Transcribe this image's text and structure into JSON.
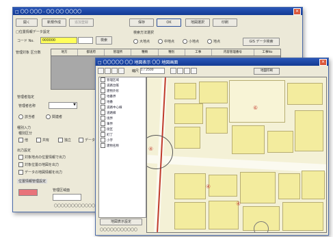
{
  "back_window": {
    "title": "□ 〇〇 〇〇〇 - 〇〇 〇〇 〇〇〇〇",
    "toolbar": [
      "開く",
      "新規作成",
      "追加登録",
      "保存",
      "OK",
      "地図選択",
      "印刷"
    ],
    "section1_label": "□位置情報データ設定",
    "field_label": "コード No.",
    "field_value": "000000",
    "nav_button": "検索",
    "right_group_label": "検索方法選択",
    "radio_options": [
      "大地点",
      "中地点",
      "小地点",
      "地点"
    ],
    "right_button": "GIS データ検索",
    "table_label": "管理対象 区分数",
    "table_headers": [
      "地方",
      "都道府",
      "管理所",
      "種類",
      "種別",
      "工事",
      "内容管理番号",
      "工事No"
    ],
    "lower_group_label": "管理者指定",
    "lower_field_label": "管理者名称",
    "lower_radio_a": "該当者",
    "lower_radio_b": "関連者",
    "block_label": "種別入力",
    "block_sublabel": "種別区分",
    "check_options": [
      "他",
      "共有",
      "独立",
      "データ"
    ],
    "output_label": "出力設定",
    "output_checks": [
      "対象地点の位置情報で出力",
      "対象位置の地図を出力",
      "データの地図情報を出力"
    ],
    "footer_label": "位置情報管理設定",
    "footer_field_label": "管理区域面",
    "footer_field_value": "",
    "status_text": "〇〇〇〇〇〇〇〇〇〇〇〇"
  },
  "front_window": {
    "title": "□ 〇〇〇〇〇 〇〇 地図表示 〇〇 地図画面",
    "zoom_label": "縮尺",
    "zoom_value": "1 / 2500",
    "right_button": "地図印刷",
    "tree_items": [
      "管理区域",
      "道路台帳",
      "建物外形",
      "地番界",
      "地番",
      "道路中心線",
      "道路縁",
      "境界",
      "筆界",
      "街区",
      "町丁",
      "小字",
      "建物名称"
    ],
    "bottom_button": "地図表示設定",
    "status_text": "〇〇〇〇〇〇〇〇〇〇〇",
    "map_labels": [
      "⑥",
      "④",
      "④",
      "④"
    ]
  },
  "colors": {
    "titlebar": "#1d4aa8",
    "map_bg": "#f4f1d6",
    "building": "#f3ec9e",
    "route": "#c0392b",
    "field_highlight": "#ffff5a"
  }
}
